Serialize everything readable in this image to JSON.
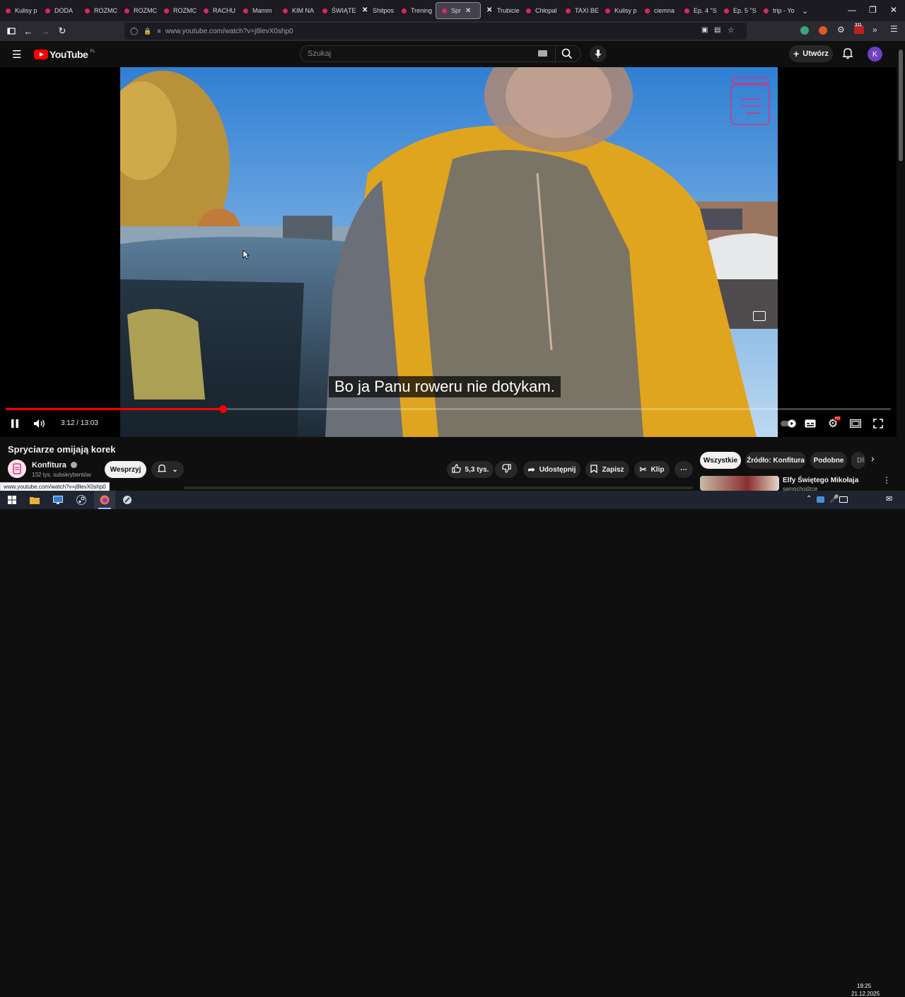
{
  "browser": {
    "tabs": [
      {
        "label": "Kulisy p",
        "icon": "youtube-favicon"
      },
      {
        "label": "DODA",
        "icon": "youtube-favicon"
      },
      {
        "label": "ROZMC",
        "icon": "youtube-favicon"
      },
      {
        "label": "ROZMC",
        "icon": "youtube-favicon"
      },
      {
        "label": "ROZMC",
        "icon": "youtube-favicon"
      },
      {
        "label": "RACHU",
        "icon": "youtube-favicon"
      },
      {
        "label": "Mamm",
        "icon": "youtube-favicon"
      },
      {
        "label": "KIM NA",
        "icon": "youtube-favicon"
      },
      {
        "label": "ŚWIĄTE",
        "icon": "youtube-favicon"
      },
      {
        "label": "Shitpos",
        "icon": "x-favicon"
      },
      {
        "label": "Trening",
        "icon": "youtube-favicon"
      },
      {
        "label": "Spr",
        "icon": "youtube-favicon",
        "active": true
      },
      {
        "label": "Trubicie",
        "icon": "x-favicon"
      },
      {
        "label": "Chłopal",
        "icon": "youtube-favicon"
      },
      {
        "label": "TAXI BE",
        "icon": "youtube-favicon"
      },
      {
        "label": "Kulisy p",
        "icon": "youtube-favicon"
      },
      {
        "label": "ciemna",
        "icon": "youtube-favicon"
      },
      {
        "label": "Ep. 4 \"S",
        "icon": "youtube-favicon"
      },
      {
        "label": "Ep. 5 \"S",
        "icon": "youtube-favicon"
      },
      {
        "label": "trip - Yo",
        "icon": "youtube-favicon"
      }
    ],
    "url": "www.youtube.com/watch?v=j8levX0shp0",
    "extension_badge": "311",
    "status_url": "www.youtube.com/watch?v=j8levX0shp0"
  },
  "youtube": {
    "logo_text": "YouTube",
    "region": "PL",
    "search_placeholder": "Szukaj",
    "create_label": "Utwórz",
    "avatar_letter": "K"
  },
  "player": {
    "subtitle": "Bo ja Panu roweru nie dotykam.",
    "time_current": "3:12",
    "time_separator": "/",
    "time_total": "13:03",
    "progress_fraction": 0.2452,
    "settings_badge": "HD"
  },
  "video_info": {
    "title": "Spryciarze omijają korek",
    "channel_name": "Konfitura",
    "subscribers": "132 tys. subskrybentów",
    "support_label": "Wesprzyj",
    "likes": "5,3 tys.",
    "share_label": "Udostępnij",
    "save_label": "Zapisz",
    "clip_label": "Klip"
  },
  "recommendations": {
    "chips": [
      "Wszystkie",
      "Źródło: Konfitura",
      "Podobne",
      "Dl"
    ],
    "first_title": "Elfy Świętego Mikołaja",
    "first_channel": "samochodzce"
  },
  "taskbar": {
    "time": "19:25",
    "date": "21.12.2025"
  },
  "colors": {
    "yt_red": "#ff0000",
    "browser_bg": "#1c1b22",
    "page_bg": "#0f0f0f"
  }
}
